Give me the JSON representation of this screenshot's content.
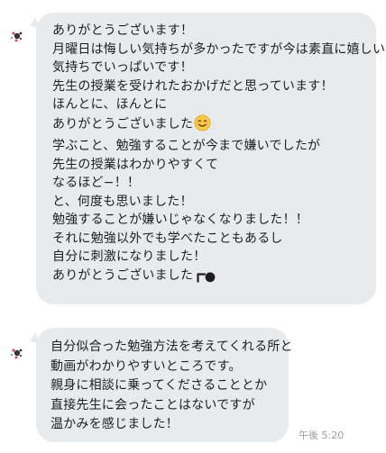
{
  "message1": {
    "lines": [
      "ありがとうございます！",
      "月曜日は悔しい気持ちが多かったですが今は素直に嬉しい",
      "気持ちでいっぱいです！",
      "先生の授業を受けれたおかげだと思っています！",
      "ほんとに、ほんとに",
      "ありがとうございました",
      "学ぶこと、勉強することが今まで嫌いでしたが",
      "先生の授業はわかりやすくて",
      "なるほど−！！",
      "と、何度も思いました！",
      "勉強することが嫌いじゃなくなりました！！",
      "それに勉強以外でも学べたこともあるし",
      "自分に刺激になりました！",
      "ありがとうございました"
    ],
    "icons": {
      "line6": "smiling-face-emoji",
      "line14": "pointing-hand-emoji"
    }
  },
  "message2": {
    "lines": [
      "自分似合った勉強方法を考えてくれる所と",
      "動画がわかりやすいところです。",
      "親身に相談に乗ってくださることとか",
      "直接先生に会ったことはないですが",
      "温かみを感じました！"
    ],
    "timestamp": "午後 5:20"
  },
  "colors": {
    "bubble": "#e8ebee",
    "text": "#1e1e1e",
    "timestamp": "#9aa0a6",
    "emoji": "#f7c948"
  }
}
